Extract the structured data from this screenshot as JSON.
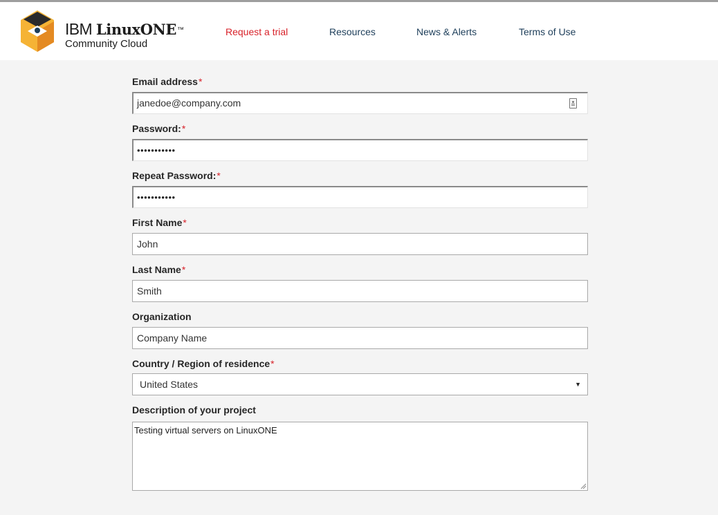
{
  "header": {
    "brand": {
      "company": "IBM",
      "product": "LinuxONE",
      "trademark": "™",
      "subtitle": "Community Cloud"
    },
    "nav": [
      {
        "label": "Request a trial",
        "active": true
      },
      {
        "label": "Resources",
        "active": false
      },
      {
        "label": "News & Alerts",
        "active": false
      },
      {
        "label": "Terms of Use",
        "active": false
      }
    ]
  },
  "form": {
    "required_marker": "*",
    "email": {
      "label": "Email address",
      "value": "janedoe@company.com",
      "required": true
    },
    "password": {
      "label": "Password:",
      "value": "•••••••••••",
      "required": true
    },
    "repeat_password": {
      "label": "Repeat Password:",
      "value": "•••••••••••",
      "required": true
    },
    "first_name": {
      "label": "First Name",
      "value": "John",
      "required": true
    },
    "last_name": {
      "label": "Last Name",
      "value": "Smith",
      "required": true
    },
    "organization": {
      "label": "Organization",
      "value": "Company Name",
      "required": false
    },
    "country": {
      "label": "Country / Region of residence",
      "selected": "United States",
      "required": true,
      "caret": "▼"
    },
    "description": {
      "label": "Description of your project",
      "value": "Testing virtual servers on LinuxONE",
      "required": false
    }
  },
  "colors": {
    "accent_red": "#d8222a",
    "nav_blue": "#1d3e5a",
    "logo_orange": "#f0a030",
    "logo_dark": "#2b2b2b",
    "page_bg": "#f4f4f4"
  }
}
